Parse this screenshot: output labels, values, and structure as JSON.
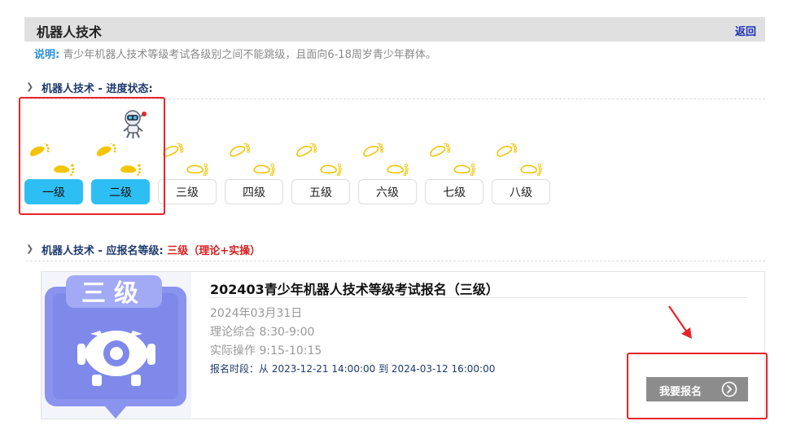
{
  "header": {
    "title": "机器人技术",
    "back_label": "返回"
  },
  "note": {
    "label": "说明:",
    "text": "青少年机器人技术等级考试各级别之间不能跳级，且面向6-18周岁青少年群体。"
  },
  "progress_section": {
    "title": "机器人技术 - 进度状态:"
  },
  "levels": [
    {
      "label": "一级",
      "status": "completed"
    },
    {
      "label": "二级",
      "status": "completed"
    },
    {
      "label": "三级",
      "status": "pending"
    },
    {
      "label": "四级",
      "status": "pending"
    },
    {
      "label": "五级",
      "status": "pending"
    },
    {
      "label": "六级",
      "status": "pending"
    },
    {
      "label": "七级",
      "status": "pending"
    },
    {
      "label": "八级",
      "status": "pending"
    }
  ],
  "apply_section": {
    "title": "机器人技术 - 应报名等级:",
    "level_text": "三级（理论+实操）"
  },
  "exam_card": {
    "badge_text": "三级",
    "title": "202403青少年机器人技术等级考试报名（三级）",
    "date": "2024年03月31日",
    "theory_time": "理论综合 8:30-9:00",
    "practice_time": "实际操作 9:15-10:15",
    "registration_period": "报名时段：从 2023-12-21 14:00:00 到 2024-03-12 16:00:00",
    "signup_label": "我要报名"
  },
  "colors": {
    "completed_level": "#2dbff3",
    "foot_yellow": "#f5c400",
    "badge_purple": "#8a93ee",
    "annotation_red": "#e8242b",
    "signup_gray": "#8c8c8c"
  }
}
